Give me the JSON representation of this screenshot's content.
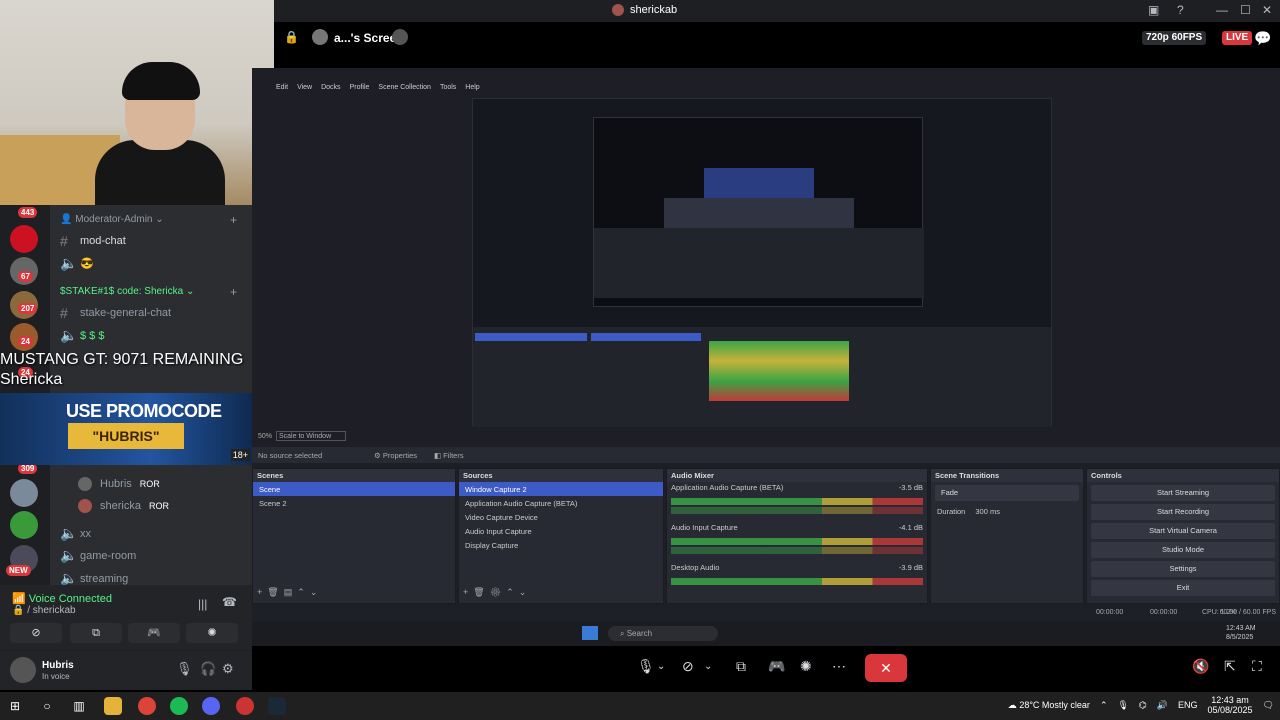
{
  "app": {
    "window_title": "sherickab",
    "stream_name": "a...'s Screen",
    "quality": "720p 60FPS",
    "live_label": "LIVE"
  },
  "sidebar": {
    "badges": [
      "443",
      "67",
      "207",
      "24",
      "24",
      "309"
    ],
    "new_label": "NEW",
    "categories": [
      {
        "label": "Moderator-Admin"
      },
      {
        "label": "$STAKE#1$ code: Shericka"
      }
    ],
    "channels": [
      {
        "label": "mod-chat",
        "icon": "hash-icon"
      },
      {
        "label": "😎",
        "icon": "speaker-icon"
      },
      {
        "label": "stake-general-chat",
        "icon": "hash-icon"
      },
      {
        "label": "$ $ $",
        "icon": "speaker-icon"
      },
      {
        "label": "xx",
        "icon": "speaker-icon"
      },
      {
        "label": "game-room",
        "icon": "speaker-icon"
      },
      {
        "label": "streaming",
        "icon": "speaker-icon"
      }
    ],
    "voice_users": [
      {
        "name": "Hubris",
        "tag": "ROR"
      },
      {
        "name": "shericka",
        "tag": "ROR"
      }
    ]
  },
  "overlay": {
    "line1": "MUSTANG GT: 9071 REMAINING",
    "line2": "Shericka",
    "promo_title": "USE PROMOCODE",
    "promo_code": "\"HUBRIS\"",
    "age": "18+"
  },
  "voice": {
    "status": "Voice Connected",
    "channel": "/ sherickab"
  },
  "user": {
    "name": "Hubris",
    "status": "In voice"
  },
  "obs": {
    "menu": [
      "Edit",
      "View",
      "Docks",
      "Profile",
      "Scene Collection",
      "Tools",
      "Help"
    ],
    "zoom": "50%",
    "scale_mode": "Scale to Window",
    "no_source": "No source selected",
    "properties_label": "Properties",
    "filters_label": "Filters",
    "scenes_title": "Scenes",
    "scenes": [
      "Scene",
      "Scene 2"
    ],
    "sources_title": "Sources",
    "sources": [
      "Window Capture 2",
      "Application Audio Capture (BETA)",
      "Video Capture Device",
      "Audio Input Capture",
      "Display Capture"
    ],
    "mixer_title": "Audio Mixer",
    "mixer": [
      {
        "name": "Application Audio Capture (BETA)",
        "db": "-3.5 dB"
      },
      {
        "name": "Audio Input Capture",
        "db": "-4.1 dB"
      },
      {
        "name": "Desktop Audio",
        "db": "-3.9 dB"
      }
    ],
    "transitions_title": "Scene Transitions",
    "transition": "Fade",
    "duration_label": "Duration",
    "duration_value": "300 ms",
    "controls_title": "Controls",
    "controls": [
      "Start Streaming",
      "Start Recording",
      "Start Virtual Camera",
      "Studio Mode",
      "Settings",
      "Exit"
    ],
    "status_time1": "00:00:00",
    "status_time2": "00:00:00",
    "cpu": "CPU: 1.2%",
    "fps": "60.00 / 60.00 FPS",
    "taskbar_search": "Search",
    "inner_time": "12:43 AM",
    "inner_date": "8/5/2025"
  },
  "taskbar": {
    "weather": "28°C  Mostly clear",
    "lang": "ENG",
    "time": "12:43 am",
    "date": "05/08/2025"
  }
}
